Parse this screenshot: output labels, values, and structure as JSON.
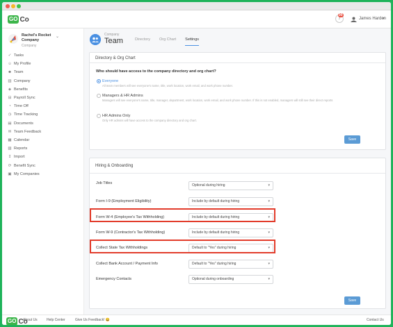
{
  "app": {
    "logo_badge": "GO",
    "logo_suffix": "Co"
  },
  "topbar": {
    "notification_count": "99",
    "user_name": "James Harden"
  },
  "company": {
    "name": "Rachel's Rocket Company",
    "subtitle": "Company"
  },
  "sidebar": {
    "items": [
      {
        "label": "Tasks",
        "icon": "check-icon"
      },
      {
        "label": "My Profile",
        "icon": "user-icon"
      },
      {
        "label": "Team",
        "icon": "team-icon"
      },
      {
        "label": "Company",
        "icon": "building-icon"
      },
      {
        "label": "Benefits",
        "icon": "shield-icon"
      },
      {
        "label": "Payroll Sync",
        "icon": "payroll-icon"
      },
      {
        "label": "Time Off",
        "icon": "clock-icon"
      },
      {
        "label": "Time Tracking",
        "icon": "stopwatch-icon"
      },
      {
        "label": "Documents",
        "icon": "document-icon"
      },
      {
        "label": "Team Feedback",
        "icon": "feedback-icon"
      },
      {
        "label": "Calendar",
        "icon": "calendar-icon"
      },
      {
        "label": "Reports",
        "icon": "reports-icon"
      },
      {
        "label": "Import",
        "icon": "import-icon"
      },
      {
        "label": "Benefit Sync",
        "icon": "sync-icon"
      },
      {
        "label": "My Companies",
        "icon": "companies-icon"
      }
    ]
  },
  "page": {
    "kicker": "Company",
    "title": "Team",
    "tabs": [
      {
        "label": "Directory",
        "active": false
      },
      {
        "label": "Org Chart",
        "active": false
      },
      {
        "label": "Settings",
        "active": true
      }
    ]
  },
  "directory_card": {
    "title": "Directory & Org Chart",
    "question": "Who should have access to the company directory and org chart?",
    "options": [
      {
        "label": "Everyone",
        "desc": "All team members will see everyone's name, title, work location, work email, and work phone number.",
        "checked": true
      },
      {
        "label": "Managers & HR Admins",
        "desc": "Managers will see everyone's name, title, manager, department, work location, work email, and work phone number. If this is not enabled, managers will still see their direct reports",
        "checked": false
      },
      {
        "label": "HR Admins Only",
        "desc": "Only HR admins will have access to the company directory and org chart.",
        "checked": false
      }
    ],
    "save_label": "Save"
  },
  "hiring_card": {
    "title": "Hiring & Onboarding",
    "rows": [
      {
        "label": "Job Titles",
        "value": "Optional during hiring"
      },
      {
        "label": "Form I-9 (Employment Eligibility)",
        "value": "Include by default during hiring"
      },
      {
        "label": "Form W-4 (Employee's Tax Withholding)",
        "value": "Include by default during hiring"
      },
      {
        "label": "Form W-9 (Contractor's Tax Withholding)",
        "value": "Include by default during hiring"
      },
      {
        "label": "Collect State Tax Withholdings",
        "value": "Default to \"Yes\" during hiring"
      },
      {
        "label": "Collect Bank Account / Payment Info",
        "value": "Default to \"Yes\" during hiring"
      },
      {
        "label": "Emergency Contacts",
        "value": "Optional during onboarding"
      }
    ],
    "save_label": "Save"
  },
  "footer": {
    "links": [
      "About Us",
      "Help Center",
      "Give Us Feedback! 😀"
    ],
    "contact": "Contact Us"
  },
  "colors": {
    "brand_green": "#3cb54a",
    "accent_blue": "#4a90e2",
    "highlight_red": "#e23b2a"
  }
}
